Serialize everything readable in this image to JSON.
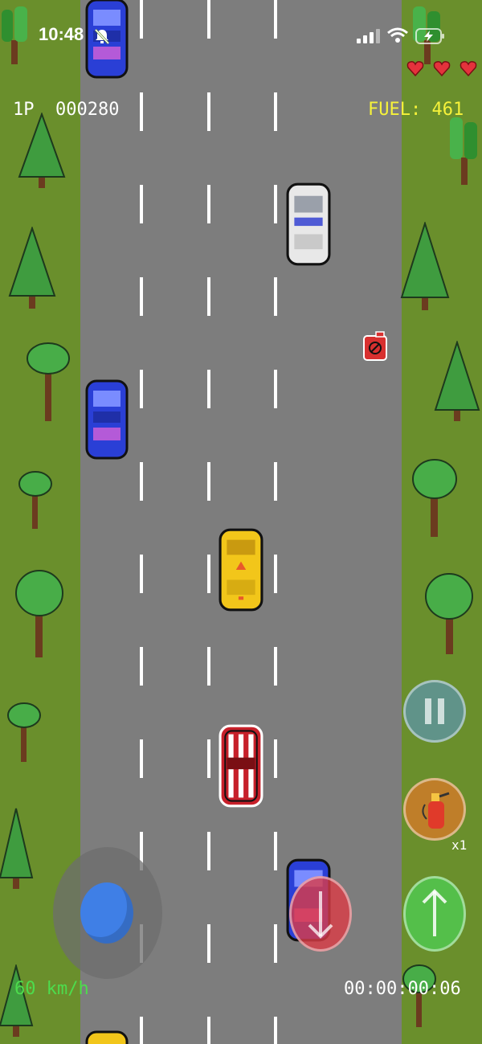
{
  "status_bar": {
    "time": "10:48",
    "icons": [
      "bell-slash-icon",
      "signal-icon",
      "wifi-icon",
      "battery-charging-icon"
    ]
  },
  "hud": {
    "score": "1P  000280",
    "fuel": "FUEL: 461",
    "speed": "60 km/h",
    "timer": "00:00:00:06",
    "lives": 3,
    "extinguisher_count": "x1"
  },
  "controls": {
    "pause_icon": "pause-icon",
    "extinguisher_icon": "fire-extinguisher-icon",
    "accelerate_icon": "arrow-up-icon",
    "brake_icon": "arrow-down-icon"
  },
  "colors": {
    "grass": "#6a8f2c",
    "road": "#7d7d7d",
    "score_text": "#ffffff",
    "fuel_text": "#f6f23a",
    "speed_text": "#4ddc4d",
    "heart": "#e4323c"
  },
  "vehicles": [
    "blue-car",
    "white-police-car",
    "blue-car",
    "yellow-taxi",
    "red-player-car",
    "blue-car",
    "yellow-taxi"
  ],
  "pickups": [
    "fuel-can"
  ]
}
